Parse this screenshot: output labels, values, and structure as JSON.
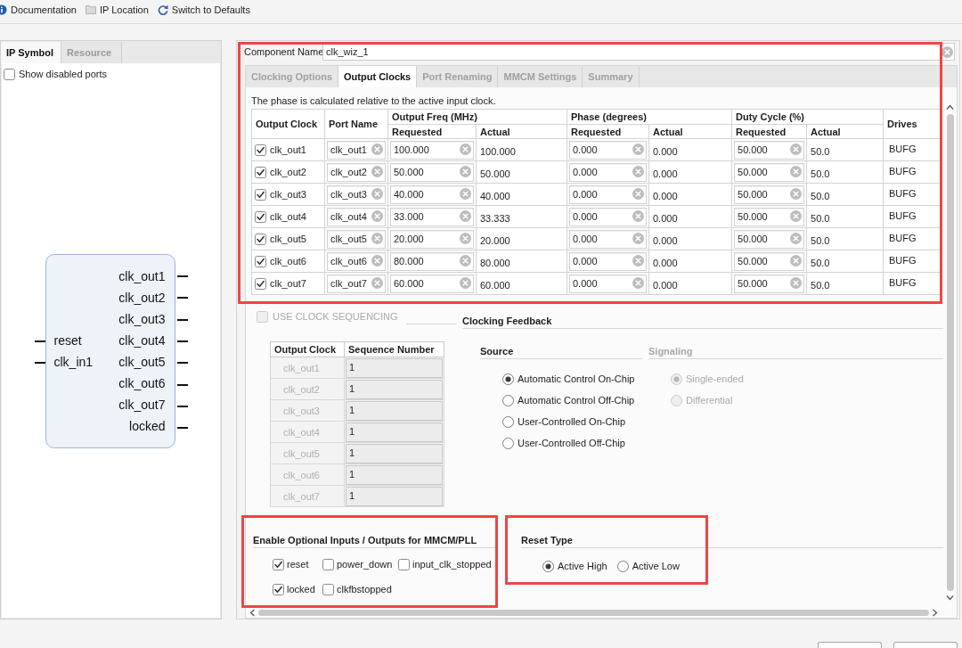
{
  "toolbar": [
    {
      "kind": "info",
      "label": "Documentation"
    },
    {
      "kind": "folder",
      "label": "IP Location"
    },
    {
      "kind": "refresh",
      "label": "Switch to Defaults"
    }
  ],
  "symbol_panel": {
    "tabs": [
      {
        "label": "IP Symbol",
        "selected": true
      },
      {
        "label": "Resource",
        "selected": false
      }
    ],
    "show_disabled_ports": {
      "label": "Show disabled ports",
      "checked": false
    },
    "symbol": {
      "inputs": [
        "reset",
        "clk_in1"
      ],
      "outputs": [
        "clk_out1",
        "clk_out2",
        "clk_out3",
        "clk_out4",
        "clk_out5",
        "clk_out6",
        "clk_out7",
        "locked"
      ]
    }
  },
  "component_name": {
    "label": "Component Name",
    "value": "clk_wiz_1"
  },
  "tabs": [
    {
      "label": "Clocking Options",
      "selected": false
    },
    {
      "label": "Output Clocks",
      "selected": true
    },
    {
      "label": "Port Renaming",
      "selected": false
    },
    {
      "label": "MMCM Settings",
      "selected": false
    },
    {
      "label": "Summary",
      "selected": false
    }
  ],
  "output_clocks": {
    "highlighted": true,
    "note": "The phase is calculated relative to the active input clock.",
    "columns": [
      {
        "label": "Output Clock"
      },
      {
        "label": "Port Name"
      },
      {
        "label": "Output Freq (MHz)",
        "subcolumns": [
          "Requested",
          "Actual"
        ]
      },
      {
        "label": "Phase (degrees)",
        "subcolumns": [
          "Requested",
          "Actual"
        ]
      },
      {
        "label": "Duty Cycle (%)",
        "subcolumns": [
          "Requested",
          "Actual"
        ]
      },
      {
        "label": "Drives"
      }
    ],
    "rows": [
      {
        "checked": true,
        "output_clock": "clk_out1",
        "port_name": "clk_out1",
        "freq_requested": "100.000",
        "freq_actual": "100.000",
        "phase_requested": "0.000",
        "phase_actual": "0.000",
        "duty_requested": "50.000",
        "duty_actual": "50.0",
        "drives": "BUFG"
      },
      {
        "checked": true,
        "output_clock": "clk_out2",
        "port_name": "clk_out2",
        "freq_requested": "50.000",
        "freq_actual": "50.000",
        "phase_requested": "0.000",
        "phase_actual": "0.000",
        "duty_requested": "50.000",
        "duty_actual": "50.0",
        "drives": "BUFG"
      },
      {
        "checked": true,
        "output_clock": "clk_out3",
        "port_name": "clk_out3",
        "freq_requested": "40.000",
        "freq_actual": "40.000",
        "phase_requested": "0.000",
        "phase_actual": "0.000",
        "duty_requested": "50.000",
        "duty_actual": "50.0",
        "drives": "BUFG"
      },
      {
        "checked": true,
        "output_clock": "clk_out4",
        "port_name": "clk_out4",
        "freq_requested": "33.000",
        "freq_actual": "33.333",
        "phase_requested": "0.000",
        "phase_actual": "0.000",
        "duty_requested": "50.000",
        "duty_actual": "50.0",
        "drives": "BUFG"
      },
      {
        "checked": true,
        "output_clock": "clk_out5",
        "port_name": "clk_out5",
        "freq_requested": "20.000",
        "freq_actual": "20.000",
        "phase_requested": "0.000",
        "phase_actual": "0.000",
        "duty_requested": "50.000",
        "duty_actual": "50.0",
        "drives": "BUFG"
      },
      {
        "checked": true,
        "output_clock": "clk_out6",
        "port_name": "clk_out6",
        "freq_requested": "80.000",
        "freq_actual": "80.000",
        "phase_requested": "0.000",
        "phase_actual": "0.000",
        "duty_requested": "50.000",
        "duty_actual": "50.0",
        "drives": "BUFG"
      },
      {
        "checked": true,
        "output_clock": "clk_out7",
        "port_name": "clk_out7",
        "freq_requested": "60.000",
        "freq_actual": "60.000",
        "phase_requested": "0.000",
        "phase_actual": "0.000",
        "duty_requested": "50.000",
        "duty_actual": "50.0",
        "drives": "BUFG"
      }
    ]
  },
  "clock_sequencing": {
    "label": "USE CLOCK SEQUENCING",
    "checked": false,
    "disabled": true,
    "columns": [
      "Output Clock",
      "Sequence Number"
    ],
    "rows": [
      {
        "output_clock": "clk_out1",
        "sequence_number": "1"
      },
      {
        "output_clock": "clk_out2",
        "sequence_number": "1"
      },
      {
        "output_clock": "clk_out3",
        "sequence_number": "1"
      },
      {
        "output_clock": "clk_out4",
        "sequence_number": "1"
      },
      {
        "output_clock": "clk_out5",
        "sequence_number": "1"
      },
      {
        "output_clock": "clk_out6",
        "sequence_number": "1"
      },
      {
        "output_clock": "clk_out7",
        "sequence_number": "1"
      }
    ]
  },
  "clocking_feedback": {
    "title": "Clocking Feedback",
    "source": {
      "title": "Source",
      "disabled": false,
      "options": [
        {
          "label": "Automatic Control On-Chip",
          "selected": true
        },
        {
          "label": "Automatic Control Off-Chip",
          "selected": false
        },
        {
          "label": "User-Controlled On-Chip",
          "selected": false
        },
        {
          "label": "User-Controlled Off-Chip",
          "selected": false
        }
      ]
    },
    "signaling": {
      "title": "Signaling",
      "disabled": true,
      "options": [
        {
          "label": "Single-ended",
          "selected": true
        },
        {
          "label": "Differential",
          "selected": false
        }
      ]
    }
  },
  "optional_ports": {
    "title": "Enable Optional Inputs / Outputs for MMCM/PLL",
    "highlighted": true,
    "items": [
      {
        "label": "reset",
        "checked": true
      },
      {
        "label": "power_down",
        "checked": false
      },
      {
        "label": "input_clk_stopped",
        "checked": false
      },
      {
        "label": "locked",
        "checked": true
      },
      {
        "label": "clkfbstopped",
        "checked": false
      }
    ]
  },
  "reset_type": {
    "title": "Reset Type",
    "highlighted": true,
    "options": [
      {
        "label": "Active High",
        "selected": true
      },
      {
        "label": "Active Low",
        "selected": false
      }
    ]
  }
}
